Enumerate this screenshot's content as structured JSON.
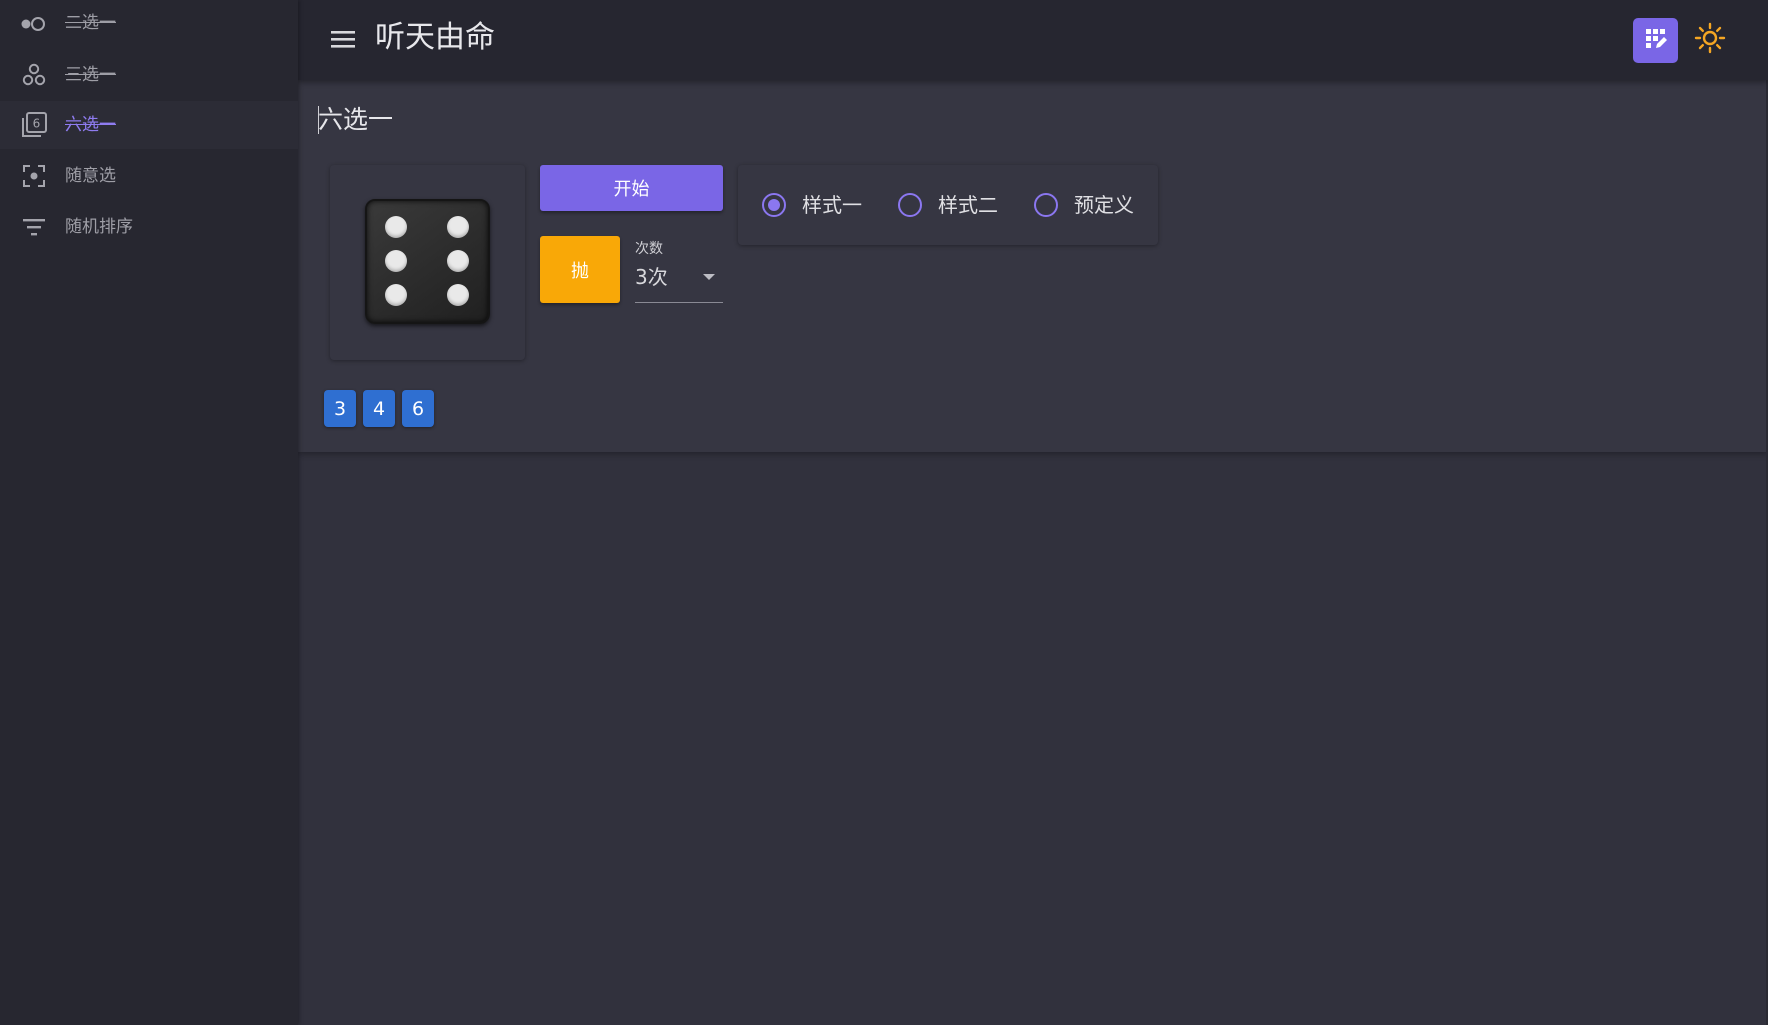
{
  "sidebar": {
    "items": [
      {
        "label": "二选一",
        "icon": "coin-toggle-icon"
      },
      {
        "label": "三选一",
        "icon": "three-circles-icon"
      },
      {
        "label": "六选一",
        "icon": "dice-six-icon"
      },
      {
        "label": "随意选",
        "icon": "center-focus-icon"
      },
      {
        "label": "随机排序",
        "icon": "filter-list-icon"
      }
    ],
    "active_index": 2
  },
  "header": {
    "title": "听天由命",
    "menu_icon": "menu-icon",
    "grid_button_icon": "grid-edit-icon",
    "theme_icon": "sun-icon"
  },
  "main": {
    "title": "六选一",
    "dice_face": 6,
    "start_label": "开始",
    "throw_label": "抛",
    "count": {
      "label": "次数",
      "value": "3次"
    },
    "styles": [
      {
        "label": "样式一",
        "selected": true
      },
      {
        "label": "样式二",
        "selected": false
      },
      {
        "label": "预定义",
        "selected": false
      }
    ],
    "results": [
      "3",
      "4",
      "6"
    ]
  },
  "colors": {
    "accent": "#7a66e6",
    "throw": "#f9a807",
    "chip": "#2f6fd1",
    "sun": "#f5a623"
  }
}
